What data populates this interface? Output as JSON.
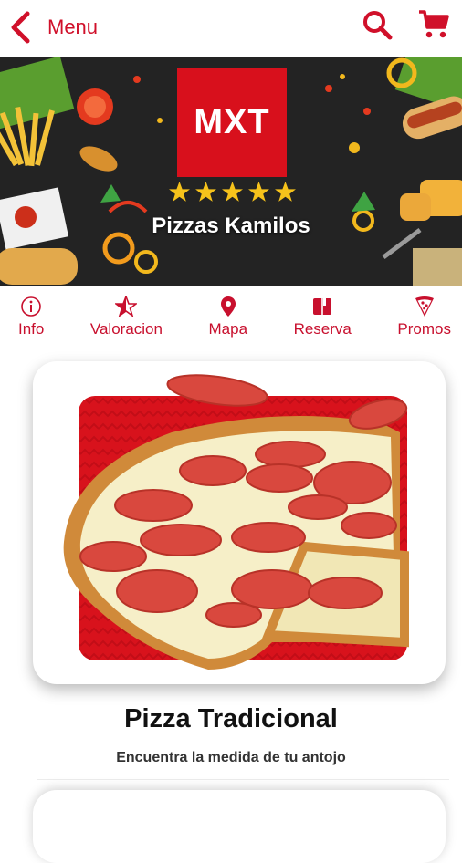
{
  "header": {
    "back_label": "Menu",
    "accent_color": "#d0102a"
  },
  "banner": {
    "logo_text": "MXT",
    "rating_stars": 5,
    "shop_name": "Pizzas Kamilos"
  },
  "tabs": [
    {
      "label": "Info",
      "icon": "info-icon"
    },
    {
      "label": "Valoracion",
      "icon": "star-rating-icon"
    },
    {
      "label": "Mapa",
      "icon": "map-pin-icon"
    },
    {
      "label": "Reserva",
      "icon": "book-icon"
    },
    {
      "label": "Promos",
      "icon": "pizza-slice-icon"
    }
  ],
  "product": {
    "title": "Pizza Tradicional",
    "subtitle": "Encuentra la medida de tu antojo"
  }
}
